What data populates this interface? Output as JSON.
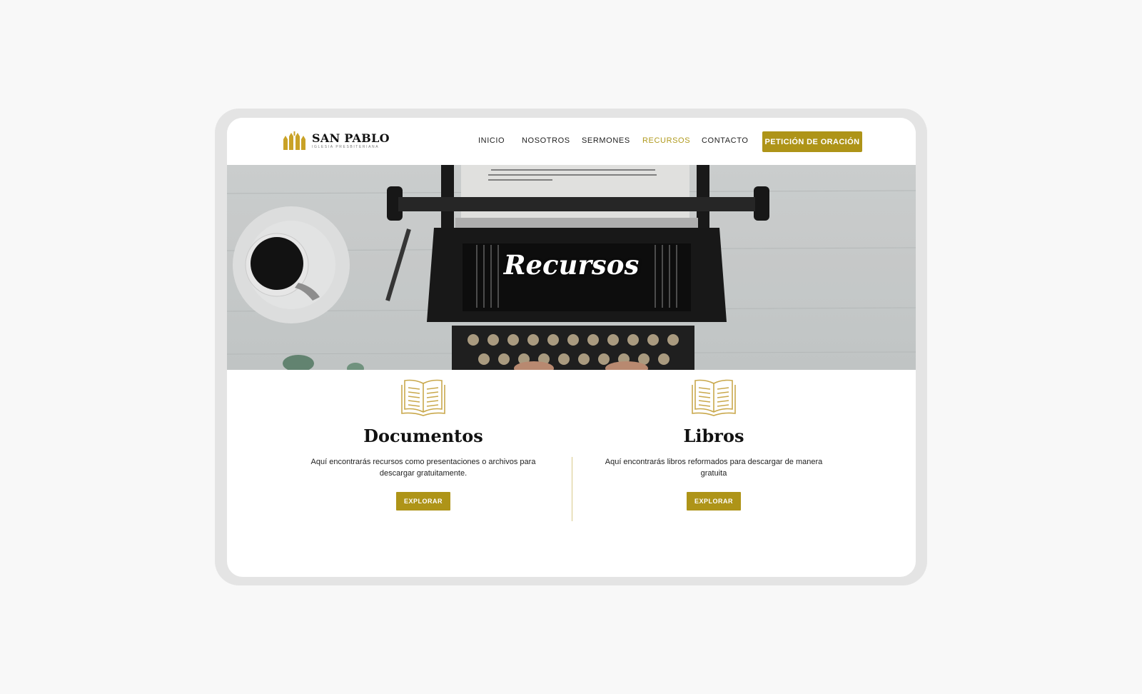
{
  "header": {
    "logo_name": "SAN PABLO",
    "logo_sub": "IGLESIA PRESBITERIANA",
    "nav": [
      {
        "label": "INICIO"
      },
      {
        "label": "NOSOTROS"
      },
      {
        "label": "SERMONES"
      },
      {
        "label": "RECURSOS",
        "active": true
      },
      {
        "label": "CONTACTO"
      }
    ],
    "cta_label": "PETICIÓN DE ORACIÓN"
  },
  "hero": {
    "title": "Recursos"
  },
  "resources": [
    {
      "title": "Documentos",
      "description": "Aquí encontrarás recursos como presentaciones o archivos para descargar gratuitamente.",
      "button": "EXPLORAR",
      "icon": "open-book-icon"
    },
    {
      "title": "Libros",
      "description": "Aquí encontrarás libros reformados para descargar de manera gratuita",
      "button": "EXPLORAR",
      "icon": "open-book-icon"
    }
  ],
  "colors": {
    "accent": "#ae9418",
    "text": "#111111",
    "background": "#f8f8f8"
  }
}
